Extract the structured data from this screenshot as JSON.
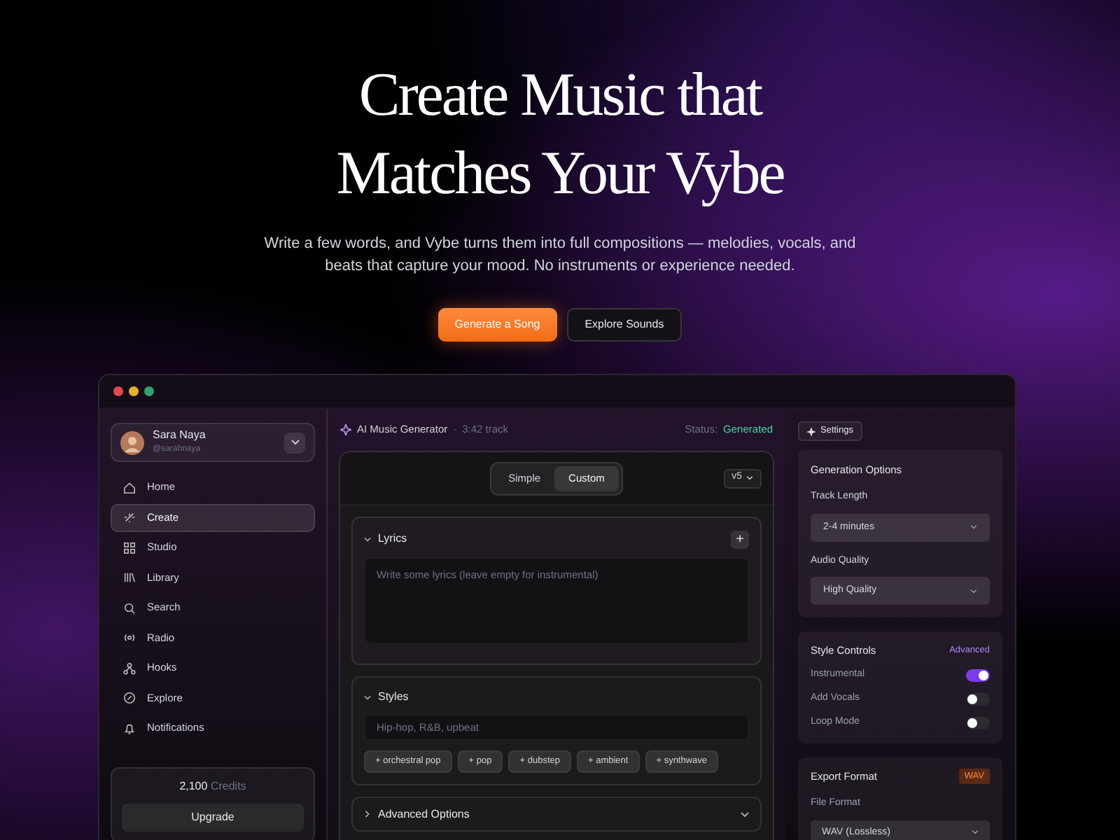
{
  "hero": {
    "title_lines": [
      "Create Music that",
      "Matches Your Vybe"
    ],
    "description": "Write a few words, and Vybe turns them into full compositions — melodies, vocals, and beats that capture your mood. No instruments or experience needed.",
    "buttons": [
      {
        "label": "Generate a Song",
        "kind": "primary"
      },
      {
        "label": "Explore Sounds",
        "kind": "secondary"
      }
    ]
  },
  "sidebar": {
    "user": {
      "name": "Sara Naya",
      "handle": "@sarahnaya"
    },
    "nav": [
      {
        "label": "Home",
        "selected": false
      },
      {
        "label": "Create",
        "selected": true
      },
      {
        "label": "Studio",
        "selected": false
      },
      {
        "label": "Library",
        "selected": false
      },
      {
        "label": "Search",
        "selected": false
      },
      {
        "label": "Radio",
        "selected": false
      },
      {
        "label": "Hooks",
        "selected": false
      },
      {
        "label": "Explore",
        "selected": false
      },
      {
        "label": "Notifications",
        "selected": false
      }
    ],
    "credits": {
      "amount": "2,100",
      "unit": "Credits"
    },
    "upgrade": "Upgrade"
  },
  "main": {
    "header": {
      "title": "AI Music Generator",
      "separator": "·",
      "track": "3:42 track",
      "status_label": "Status:",
      "status_value": "Generated"
    },
    "mode_tabs": [
      {
        "label": "Simple",
        "selected": false
      },
      {
        "label": "Custom",
        "selected": true
      }
    ],
    "version": "v5",
    "lyrics": {
      "title": "Lyrics",
      "expanded": true,
      "add": "+",
      "placeholder": "Write some lyrics (leave empty for instrumental)"
    },
    "styles": {
      "title": "Styles",
      "expanded": true,
      "placeholder": "Hip-hop, R&B, upbeat",
      "tags": [
        "+ orchestral pop",
        "+ pop",
        "+ dubstep",
        "+ ambient",
        "+ synthwave"
      ]
    },
    "advanced": {
      "title": "Advanced Options",
      "expanded": false
    }
  },
  "settings": {
    "button": "Settings",
    "generation": {
      "title": "Generation Options",
      "fields": [
        {
          "label": "Track Length",
          "value": "2-4 minutes"
        },
        {
          "label": "Audio Quality",
          "value": "High Quality"
        }
      ]
    },
    "style_controls": {
      "title": "Style Controls",
      "link": "Advanced",
      "toggles": [
        {
          "label": "Instrumental",
          "on": true
        },
        {
          "label": "Add Vocals",
          "on": false
        },
        {
          "label": "Loop Mode",
          "on": false
        }
      ]
    },
    "export": {
      "title": "Export Format",
      "badge": "WAV",
      "field": {
        "label": "File Format",
        "value": "WAV (Lossless)"
      }
    }
  }
}
